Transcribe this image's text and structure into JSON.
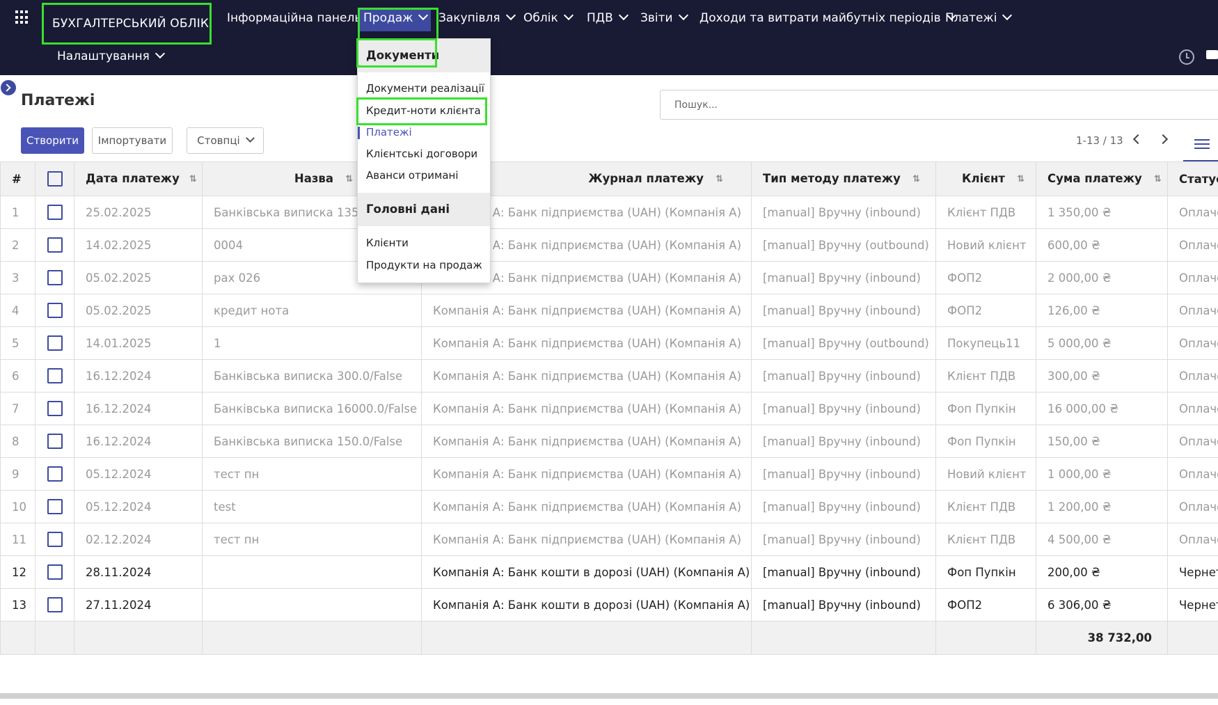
{
  "app": {
    "title": "БУХГАЛТЕРСЬКИЙ ОБЛІК"
  },
  "menu": {
    "dashboard": "Інформаційна панель",
    "sales": "Продаж",
    "purchases": "Закупівля",
    "accounting": "Облік",
    "vat": "ПДВ",
    "reports": "Звіти",
    "deferred": "Доходи та витрати майбутніх періодів",
    "payments": "Платежі",
    "settings": "Налаштування"
  },
  "dropdown": {
    "section_documents": "Документи",
    "items": [
      "Документи реалізації",
      "Кредит-ноти клієнта",
      "Платежі",
      "Клієнтські договори",
      "Аванси отримані"
    ],
    "section_master": "Головні дані",
    "master_items": [
      "Клієнти",
      "Продукти на продаж"
    ]
  },
  "page": {
    "title": "Платежі",
    "search_placeholder": "Пошук...",
    "create": "Створити",
    "import": "Імпортувати",
    "columns": "Стовпці",
    "pager": "1-13 / 13"
  },
  "table": {
    "headers": [
      "#",
      "Дата платежу",
      "Назва",
      "Журнал платежу",
      "Тип методу платежу",
      "Клієнт",
      "Сума платежу",
      "Статус"
    ],
    "rows": [
      {
        "n": "1",
        "date": "25.02.2025",
        "name": "Банківська виписка 1350.0/False",
        "journal": "Компанія А: Банк підприємства (UAH) (Компанія А)",
        "method": "[manual] Вручну (inbound)",
        "client": "Клієнт ПДВ",
        "amount": "1 350,00 ₴",
        "status": "Оплачено"
      },
      {
        "n": "2",
        "date": "14.02.2025",
        "name": "0004",
        "journal": "Компанія А: Банк підприємства (UAH) (Компанія А)",
        "method": "[manual] Вручну (outbound)",
        "client": "Новий клієнт",
        "amount": "600,00 ₴",
        "status": "Оплачено"
      },
      {
        "n": "3",
        "date": "05.02.2025",
        "name": "рах 026",
        "journal": "Компанія А: Банк підприємства (UAH) (Компанія А)",
        "method": "[manual] Вручну (inbound)",
        "client": "ФОП2",
        "amount": "2 000,00 ₴",
        "status": "Оплачено"
      },
      {
        "n": "4",
        "date": "05.02.2025",
        "name": "кредит нота",
        "journal": "Компанія А: Банк підприємства (UAH) (Компанія А)",
        "method": "[manual] Вручну (inbound)",
        "client": "ФОП2",
        "amount": "126,00 ₴",
        "status": "Оплачено"
      },
      {
        "n": "5",
        "date": "14.01.2025",
        "name": "1",
        "journal": "Компанія А: Банк підприємства (UAH) (Компанія А)",
        "method": "[manual] Вручну (outbound)",
        "client": "Покупець11",
        "amount": "5 000,00 ₴",
        "status": "Оплачено"
      },
      {
        "n": "6",
        "date": "16.12.2024",
        "name": "Банківська виписка 300.0/False",
        "journal": "Компанія А: Банк підприємства (UAH) (Компанія А)",
        "method": "[manual] Вручну (inbound)",
        "client": "Клієнт ПДВ",
        "amount": "300,00 ₴",
        "status": "Оплачено"
      },
      {
        "n": "7",
        "date": "16.12.2024",
        "name": "Банківська виписка 16000.0/False",
        "journal": "Компанія А: Банк підприємства (UAH) (Компанія А)",
        "method": "[manual] Вручну (inbound)",
        "client": "Фоп Пупкін",
        "amount": "16 000,00 ₴",
        "status": "Оплачено"
      },
      {
        "n": "8",
        "date": "16.12.2024",
        "name": "Банківська виписка 150.0/False",
        "journal": "Компанія А: Банк підприємства (UAH) (Компанія А)",
        "method": "[manual] Вручну (inbound)",
        "client": "Фоп Пупкін",
        "amount": "150,00 ₴",
        "status": "Оплачено"
      },
      {
        "n": "9",
        "date": "05.12.2024",
        "name": "тест пн",
        "journal": "Компанія А: Банк підприємства (UAH) (Компанія А)",
        "method": "[manual] Вручну (inbound)",
        "client": "Новий клієнт",
        "amount": "1 000,00 ₴",
        "status": "Оплачено"
      },
      {
        "n": "10",
        "date": "05.12.2024",
        "name": "test",
        "journal": "Компанія А: Банк підприємства (UAH) (Компанія А)",
        "method": "[manual] Вручну (inbound)",
        "client": "Клієнт ПДВ",
        "amount": "1 200,00 ₴",
        "status": "Оплачено"
      },
      {
        "n": "11",
        "date": "02.12.2024",
        "name": "тест пн",
        "journal": "Компанія А: Банк підприємства (UAH) (Компанія А)",
        "method": "[manual] Вручну (inbound)",
        "client": "Клієнт ПДВ",
        "amount": "4 500,00 ₴",
        "status": "Оплачено"
      },
      {
        "n": "12",
        "date": "28.11.2024",
        "name": "",
        "journal": "Компанія А: Банк кошти в дорозі (UAH) (Компанія А)",
        "method": "[manual] Вручну (inbound)",
        "client": "Фоп Пупкін",
        "amount": "200,00 ₴",
        "status": "Чернетка"
      },
      {
        "n": "13",
        "date": "27.11.2024",
        "name": "",
        "journal": "Компанія А: Банк кошти в дорозі (UAH) (Компанія А)",
        "method": "[manual] Вручну (inbound)",
        "client": "ФОП2",
        "amount": "6 306,00 ₴",
        "status": "Чернетка"
      }
    ],
    "total": "38 732,00"
  }
}
